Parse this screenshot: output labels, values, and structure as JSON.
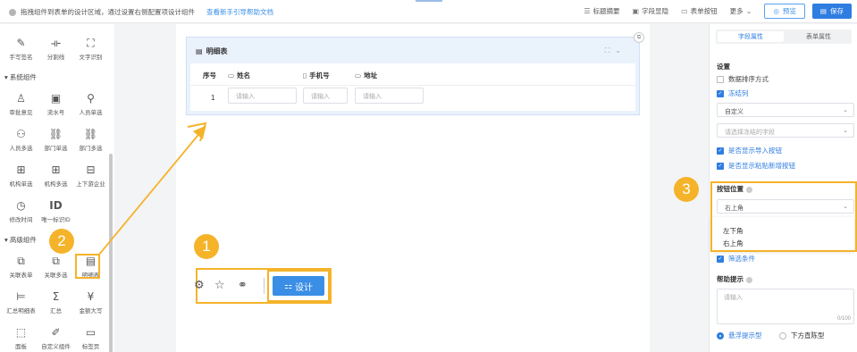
{
  "topbar": {
    "hint": "拖拽组件到表单的设计区域，通过设置右侧配置项设计组件",
    "help_link": "查看新手引导帮助文档",
    "actions": [
      {
        "icon": "summary-icon",
        "label": "标题摘要"
      },
      {
        "icon": "field-hide-icon",
        "label": "字段显隐"
      },
      {
        "icon": "form-button-icon",
        "label": "表单按钮"
      },
      {
        "icon": "chevron-down-icon",
        "label": "更多"
      }
    ],
    "preview_label": "预览",
    "save_label": "保存"
  },
  "left_panel": {
    "top_items": [
      {
        "icon": "handwrite-icon",
        "label": "手写签名"
      },
      {
        "icon": "divider-icon",
        "label": "分割线"
      },
      {
        "icon": "ocr-icon",
        "label": "文字识别"
      }
    ],
    "system_section": "系统组件",
    "system_items": [
      [
        "审批意见",
        "流水号",
        "人员单选"
      ],
      [
        "人员多选",
        "部门单选",
        "部门多选"
      ],
      [
        "机构单选",
        "机构多选",
        "上下游企业"
      ],
      [
        "修改时间",
        "唯一标识ID"
      ]
    ],
    "advanced_section": "高级组件",
    "advanced_items": [
      [
        "关联表单",
        "关联多选",
        "明细表"
      ],
      [
        "汇总明细表",
        "汇总",
        "金额大写"
      ],
      [
        "面板",
        "自定义组件",
        "标签页"
      ]
    ]
  },
  "canvas": {
    "table_title": "明细表",
    "columns": [
      "序号",
      "姓名",
      "手机号",
      "地址"
    ],
    "row_number": "1",
    "placeholder": "请输入",
    "design_label": "设计"
  },
  "annotations": {
    "one": "1",
    "two": "2",
    "three": "3"
  },
  "right_panel": {
    "tabs": [
      "字段属性",
      "表单属性"
    ],
    "settings_label": "设置",
    "data_sort": "数据排序方式",
    "freeze_col": "冻结列",
    "custom_select": "自定义",
    "freeze_placeholder": "请选择冻结的字段",
    "show_import": "是否显示导入按钮",
    "show_paste": "是否显示粘贴新增按钮",
    "button_position_label": "按钮位置",
    "button_position_value": "右上角",
    "options": [
      "左下角",
      "右上角"
    ],
    "filter_label": "筛选条件",
    "help_label": "帮助提示",
    "help_placeholder": "请输入",
    "help_count": "0/100",
    "radio_float": "悬浮提示型",
    "radio_below": "下方直陈型"
  },
  "colors": {
    "accent": "#2f7de1",
    "highlight": "#f5b32a"
  }
}
